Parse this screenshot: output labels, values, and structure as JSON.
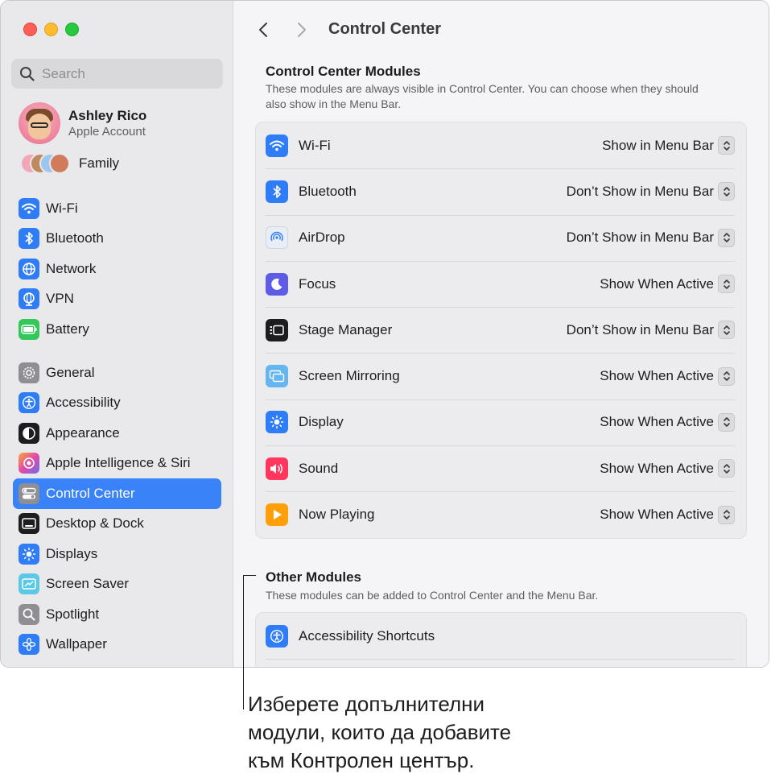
{
  "sidebar": {
    "search": {
      "placeholder": "Search"
    },
    "account": {
      "name": "Ashley Rico",
      "subtitle": "Apple Account"
    },
    "family_label": "Family",
    "group1": [
      {
        "label": "Wi-Fi",
        "icon": "wifi-icon",
        "color": "#2f7df6"
      },
      {
        "label": "Bluetooth",
        "icon": "bluetooth-icon",
        "color": "#2f7df6"
      },
      {
        "label": "Network",
        "icon": "globe-icon",
        "color": "#2f7df6"
      },
      {
        "label": "VPN",
        "icon": "vpn-globe-icon",
        "color": "#2f7df6"
      },
      {
        "label": "Battery",
        "icon": "battery-icon",
        "color": "#34c759"
      }
    ],
    "group2": [
      {
        "label": "General",
        "icon": "gear-icon",
        "color": "#8e8e93"
      },
      {
        "label": "Accessibility",
        "icon": "accessibility-icon",
        "color": "#2f7df6"
      },
      {
        "label": "Appearance",
        "icon": "appearance-icon",
        "color": "#1d1d1f"
      },
      {
        "label": "Apple Intelligence & Siri",
        "icon": "siri-icon",
        "color": "#c26be0"
      },
      {
        "label": "Control Center",
        "icon": "control-center-icon",
        "color": "#8e8e93",
        "selected": true
      },
      {
        "label": "Desktop & Dock",
        "icon": "dock-icon",
        "color": "#1d1d1f"
      },
      {
        "label": "Displays",
        "icon": "sun-icon",
        "color": "#2f7df6"
      },
      {
        "label": "Screen Saver",
        "icon": "screen-saver-icon",
        "color": "#5ac8e6"
      },
      {
        "label": "Spotlight",
        "icon": "magnifier-icon",
        "color": "#8e8e93"
      },
      {
        "label": "Wallpaper",
        "icon": "flower-icon",
        "color": "#2f7df6"
      }
    ]
  },
  "content": {
    "title": "Control Center",
    "modules": {
      "title": "Control Center Modules",
      "description": "These modules are always visible in Control Center. You can choose when they should also show in the Menu Bar.",
      "rows": [
        {
          "label": "Wi-Fi",
          "value": "Show in Menu Bar",
          "icon": "wifi-icon",
          "color": "#2f7df6"
        },
        {
          "label": "Bluetooth",
          "value": "Don’t Show in Menu Bar",
          "icon": "bluetooth-icon",
          "color": "#2f7df6"
        },
        {
          "label": "AirDrop",
          "value": "Don’t Show in Menu Bar",
          "icon": "airdrop-icon",
          "color": "#e9eef6"
        },
        {
          "label": "Focus",
          "value": "Show When Active",
          "icon": "moon-icon",
          "color": "#5e5ce6"
        },
        {
          "label": "Stage Manager",
          "value": "Don’t Show in Menu Bar",
          "icon": "stage-manager-icon",
          "color": "#1d1d1f"
        },
        {
          "label": "Screen Mirroring",
          "value": "Show When Active",
          "icon": "screen-mirroring-icon",
          "color": "#64b5f0"
        },
        {
          "label": "Display",
          "value": "Show When Active",
          "icon": "sun-icon",
          "color": "#2f7df6"
        },
        {
          "label": "Sound",
          "value": "Show When Active",
          "icon": "speaker-icon",
          "color": "#ff375f"
        },
        {
          "label": "Now Playing",
          "value": "Show When Active",
          "icon": "play-icon",
          "color": "#ff9f0a"
        }
      ]
    },
    "other": {
      "title": "Other Modules",
      "description": "These modules can be added to Control Center and the Menu Bar.",
      "rows": [
        {
          "label": "Accessibility Shortcuts",
          "icon": "accessibility-icon",
          "color": "#2f7df6"
        }
      ]
    }
  },
  "callout": {
    "line1": "Изберете допълнителни",
    "line2": "модули, които да добавите",
    "line3": "към Контролен център."
  }
}
